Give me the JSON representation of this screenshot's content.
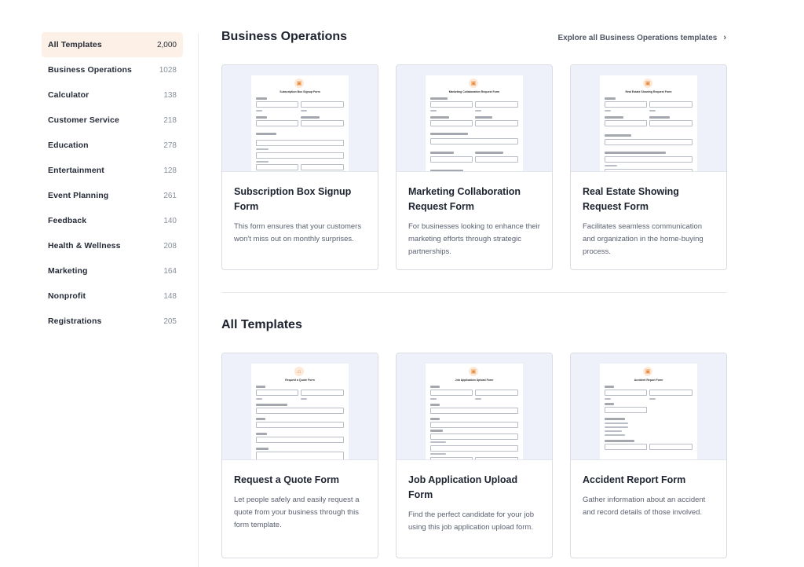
{
  "sidebar": {
    "items": [
      {
        "label": "All Templates",
        "count": "2,000"
      },
      {
        "label": "Business Operations",
        "count": "1028"
      },
      {
        "label": "Calculator",
        "count": "138"
      },
      {
        "label": "Customer Service",
        "count": "218"
      },
      {
        "label": "Education",
        "count": "278"
      },
      {
        "label": "Entertainment",
        "count": "128"
      },
      {
        "label": "Event Planning",
        "count": "261"
      },
      {
        "label": "Feedback",
        "count": "140"
      },
      {
        "label": "Health & Wellness",
        "count": "208"
      },
      {
        "label": "Marketing",
        "count": "164"
      },
      {
        "label": "Nonprofit",
        "count": "148"
      },
      {
        "label": "Registrations",
        "count": "205"
      }
    ],
    "active_index": 0
  },
  "business_ops": {
    "title": "Business Operations",
    "explore_label": "Explore all Business Operations templates",
    "explore_icon": "chevron-right-icon",
    "cards": [
      {
        "title": "Subscription Box Signup Form",
        "desc": "This form ensures that your customers won't miss out on monthly surprises.",
        "preview_title": "Subscription Box Signup Form"
      },
      {
        "title": "Marketing Collaboration Request Form",
        "desc": "For businesses looking to enhance their marketing efforts through strategic partnerships.",
        "preview_title": "Marketing Collaboration Request Form"
      },
      {
        "title": "Real Estate Showing Request Form",
        "desc": "Facilitates seamless communication and organization in the home-buying process.",
        "preview_title": "Real Estate Showing Request Form"
      }
    ]
  },
  "all_templates": {
    "title": "All Templates",
    "cards": [
      {
        "title": "Request a Quote Form",
        "desc": "Let people safely and easily request a quote from your business through this form template.",
        "preview_title": "Request a Quote Form"
      },
      {
        "title": "Job Application Upload Form",
        "desc": "Find the perfect candidate for your job using this job application upload form.",
        "preview_title": "Job Application Upload Form"
      },
      {
        "title": "Accident Report Form",
        "desc": "Gather information about an accident and record details of those involved.",
        "preview_title": "Accident Report Form"
      }
    ]
  },
  "colors": {
    "active_bg": "#fdf1e7",
    "preview_bg": "#eef1f9",
    "logo_accent": "#e8883a",
    "border": "#dadce1"
  }
}
